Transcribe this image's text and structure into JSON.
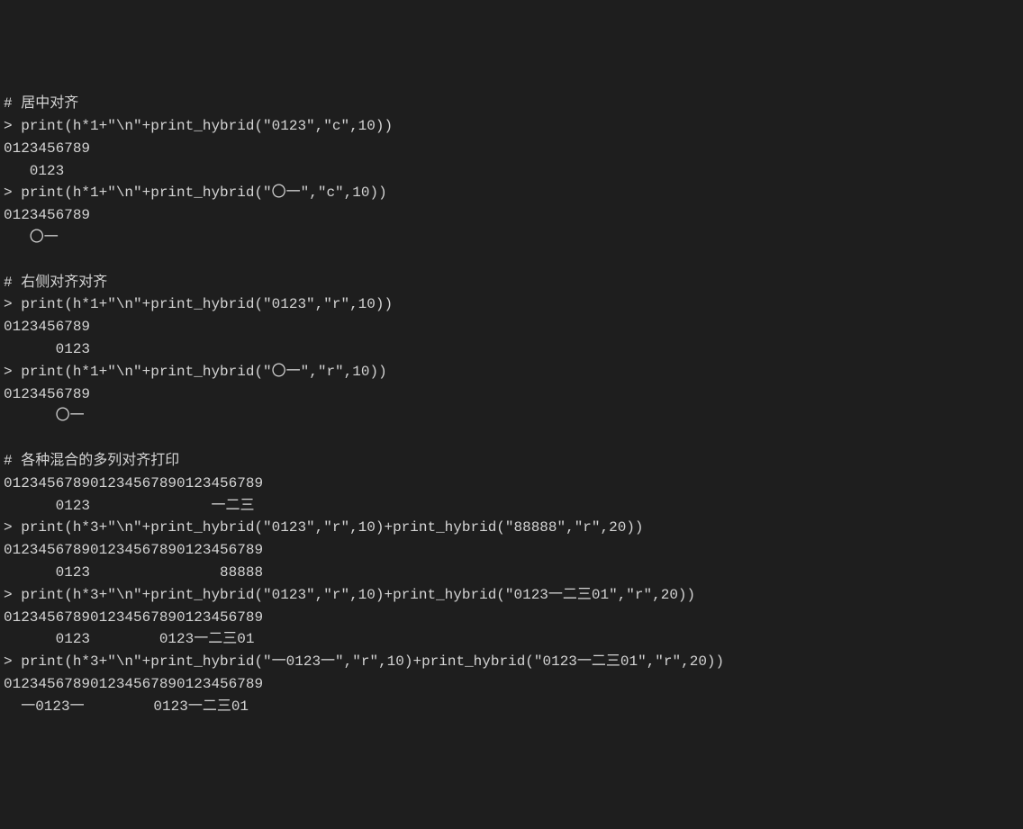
{
  "lines": [
    "# 居中对齐",
    "> print(h*1+\"\\n\"+print_hybrid(\"0123\",\"c\",10))",
    "0123456789",
    "   0123",
    "> print(h*1+\"\\n\"+print_hybrid(\"〇一\",\"c\",10))",
    "0123456789",
    "   〇一",
    "",
    "# 右侧对齐对齐",
    "> print(h*1+\"\\n\"+print_hybrid(\"0123\",\"r\",10))",
    "0123456789",
    "      0123",
    "> print(h*1+\"\\n\"+print_hybrid(\"〇一\",\"r\",10))",
    "0123456789",
    "      〇一",
    "",
    "# 各种混合的多列对齐打印",
    "012345678901234567890123456789",
    "      0123              一二三",
    "> print(h*3+\"\\n\"+print_hybrid(\"0123\",\"r\",10)+print_hybrid(\"88888\",\"r\",20))",
    "012345678901234567890123456789",
    "      0123               88888",
    "> print(h*3+\"\\n\"+print_hybrid(\"0123\",\"r\",10)+print_hybrid(\"0123一二三01\",\"r\",20))",
    "012345678901234567890123456789",
    "      0123        0123一二三01",
    "> print(h*3+\"\\n\"+print_hybrid(\"一0123一\",\"r\",10)+print_hybrid(\"0123一二三01\",\"r\",20))",
    "012345678901234567890123456789",
    "  一0123一        0123一二三01"
  ]
}
